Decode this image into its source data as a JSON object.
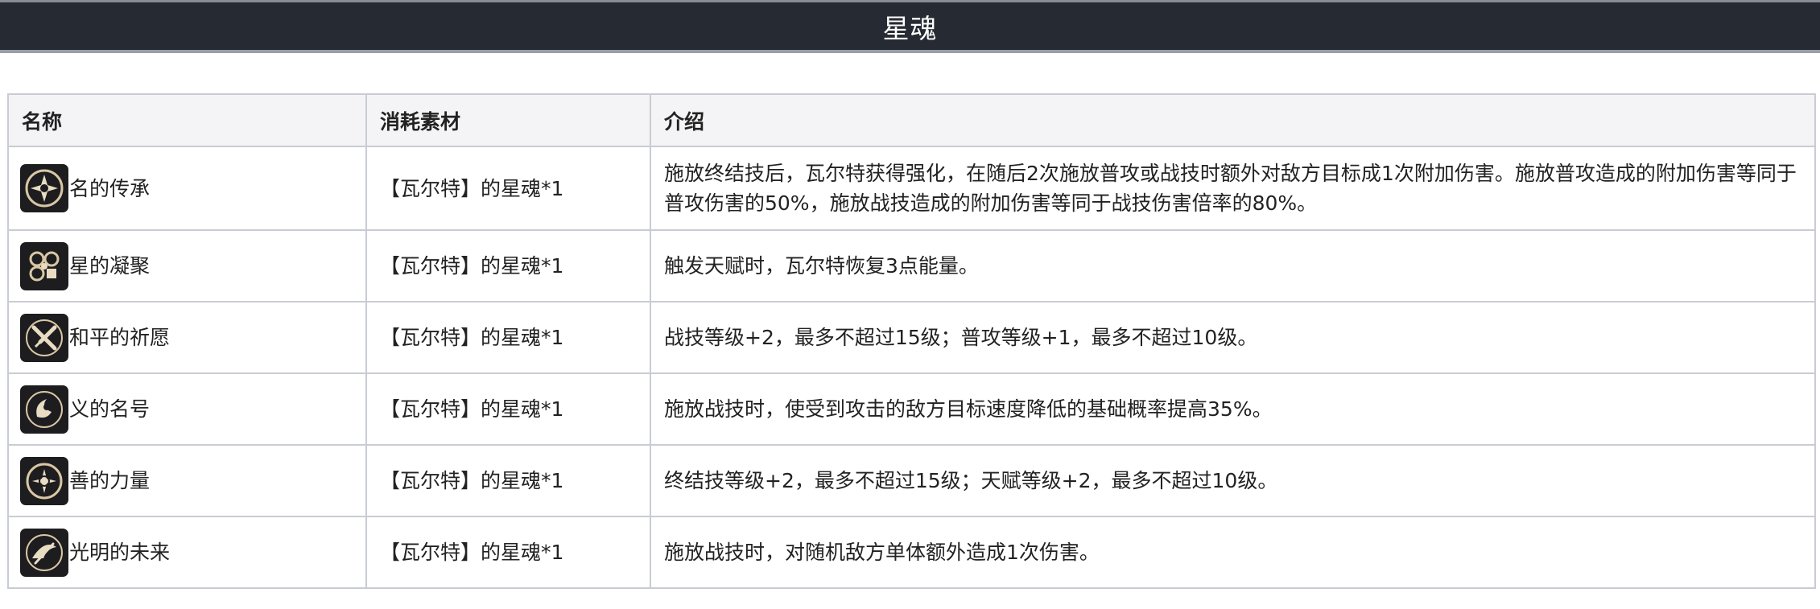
{
  "header": {
    "title": "星魂"
  },
  "table": {
    "columns": [
      "名称",
      "消耗素材",
      "介绍"
    ],
    "rows": [
      {
        "icon": "constellation-1-icon",
        "name": "名的传承",
        "material": "【瓦尔特】的星魂*1",
        "description": "施放终结技后，瓦尔特获得强化，在随后2次施放普攻或战技时额外对敌方目标成1次附加伤害。施放普攻造成的附加伤害等同于普攻伤害的50%，施放战技造成的附加伤害等同于战技伤害倍率的80%。"
      },
      {
        "icon": "constellation-2-icon",
        "name": "星的凝聚",
        "material": "【瓦尔特】的星魂*1",
        "description": "触发天赋时，瓦尔特恢复3点能量。"
      },
      {
        "icon": "constellation-3-icon",
        "name": "和平的祈愿",
        "material": "【瓦尔特】的星魂*1",
        "description": "战技等级+2，最多不超过15级；普攻等级+1，最多不超过10级。"
      },
      {
        "icon": "constellation-4-icon",
        "name": "义的名号",
        "material": "【瓦尔特】的星魂*1",
        "description": "施放战技时，使受到攻击的敌方目标速度降低的基础概率提高35%。"
      },
      {
        "icon": "constellation-5-icon",
        "name": "善的力量",
        "material": "【瓦尔特】的星魂*1",
        "description": "终结技等级+2，最多不超过15级；天赋等级+2，最多不超过10级。"
      },
      {
        "icon": "constellation-6-icon",
        "name": "光明的未来",
        "material": "【瓦尔特】的星魂*1",
        "description": "施放战技时，对随机敌方单体额外造成1次伤害。"
      }
    ]
  }
}
